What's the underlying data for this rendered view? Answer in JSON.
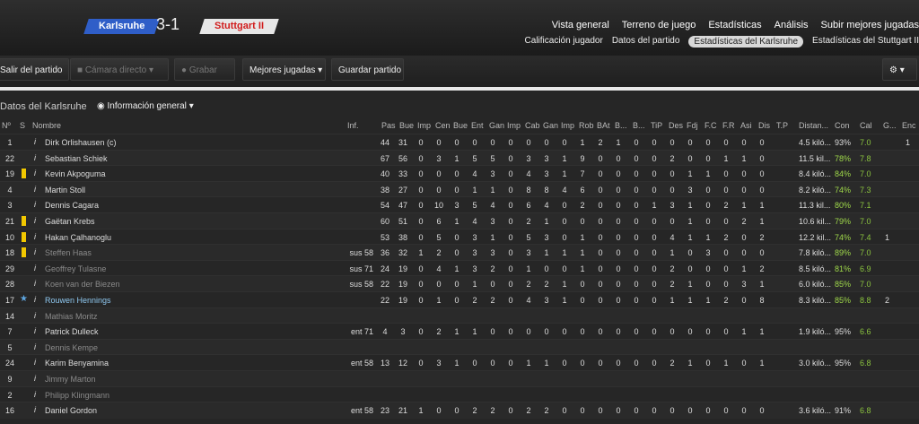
{
  "match": {
    "home": "Karlsruhe",
    "score": "3-1",
    "away": "Stuttgart II"
  },
  "nav_main": [
    "Vista general",
    "Terreno de juego",
    "Estadísticas",
    "Análisis",
    "Subir mejores jugadas"
  ],
  "nav_sub": [
    "Calificación jugador",
    "Datos del partido",
    "Estadísticas del Karlsruhe",
    "Estadísticas del Stuttgart II"
  ],
  "toolbar": {
    "exit": "Salir del partido",
    "camera": "Cámara directo",
    "record": "Grabar",
    "best": "Mejores jugadas",
    "save": "Guardar partido"
  },
  "section": {
    "title": "Datos del Karlsruhe",
    "view": "Información general"
  },
  "columns": [
    "Nº",
    "S",
    "Nombre",
    "Inf.",
    "Pas",
    "Bue",
    "Imp",
    "Cen",
    "Bue",
    "Ent",
    "Gan",
    "Imp",
    "Cab",
    "Gan",
    "Imp",
    "Rob",
    "BAt",
    "B...",
    "B...",
    "TiP",
    "Des",
    "Fdj",
    "F.C",
    "F.R",
    "Asi",
    "Dis",
    "T.P",
    "Distan...",
    "Con",
    "Cal",
    "G...",
    "Enc"
  ],
  "rows": [
    {
      "n": "1",
      "card": "",
      "name": "Dirk Orlishausen (c)",
      "inf": "",
      "style": "",
      "v": [
        "44",
        "31",
        "0",
        "0",
        "0",
        "0",
        "0",
        "0",
        "0",
        "0",
        "0",
        "1",
        "2",
        "1",
        "0",
        "0",
        "0",
        "0",
        "0",
        "0",
        "0",
        "0"
      ],
      "dist": "4.5 kiló...",
      "con": "93%",
      "cal": "7.0",
      "g": "",
      "enc": "1"
    },
    {
      "n": "22",
      "card": "",
      "name": "Sebastian Schiek",
      "inf": "",
      "style": "",
      "v": [
        "67",
        "56",
        "0",
        "3",
        "1",
        "5",
        "5",
        "0",
        "3",
        "3",
        "1",
        "9",
        "0",
        "0",
        "0",
        "0",
        "2",
        "0",
        "0",
        "1",
        "1",
        "0"
      ],
      "dist": "11.5 kil...",
      "con": "78%",
      "cal": "7.8",
      "g": "",
      "enc": ""
    },
    {
      "n": "19",
      "card": "y",
      "name": "Kevin Akpoguma",
      "inf": "",
      "style": "",
      "v": [
        "40",
        "33",
        "0",
        "0",
        "0",
        "4",
        "3",
        "0",
        "4",
        "3",
        "1",
        "7",
        "0",
        "0",
        "0",
        "0",
        "0",
        "1",
        "1",
        "0",
        "0",
        "0"
      ],
      "dist": "8.4 kiló...",
      "con": "84%",
      "cal": "7.0",
      "g": "",
      "enc": ""
    },
    {
      "n": "4",
      "card": "",
      "name": "Martin Stoll",
      "inf": "",
      "style": "",
      "v": [
        "38",
        "27",
        "0",
        "0",
        "0",
        "1",
        "1",
        "0",
        "8",
        "8",
        "4",
        "6",
        "0",
        "0",
        "0",
        "0",
        "0",
        "3",
        "0",
        "0",
        "0",
        "0"
      ],
      "dist": "8.2 kiló...",
      "con": "74%",
      "cal": "7.3",
      "g": "",
      "enc": ""
    },
    {
      "n": "3",
      "card": "",
      "name": "Dennis Cagara",
      "inf": "",
      "style": "",
      "v": [
        "54",
        "47",
        "0",
        "10",
        "3",
        "5",
        "4",
        "0",
        "6",
        "4",
        "0",
        "2",
        "0",
        "0",
        "0",
        "1",
        "3",
        "1",
        "0",
        "2",
        "1",
        "1"
      ],
      "dist": "11.3 kil...",
      "con": "80%",
      "cal": "7.1",
      "g": "",
      "enc": ""
    },
    {
      "n": "21",
      "card": "y",
      "name": "Gaëtan Krebs",
      "inf": "",
      "style": "",
      "v": [
        "60",
        "51",
        "0",
        "6",
        "1",
        "4",
        "3",
        "0",
        "2",
        "1",
        "0",
        "0",
        "0",
        "0",
        "0",
        "0",
        "0",
        "1",
        "0",
        "0",
        "2",
        "1"
      ],
      "dist": "10.6 kil...",
      "con": "79%",
      "cal": "7.0",
      "g": "",
      "enc": ""
    },
    {
      "n": "10",
      "card": "y",
      "name": "Hakan Çalhanoglu",
      "inf": "",
      "style": "",
      "v": [
        "53",
        "38",
        "0",
        "5",
        "0",
        "3",
        "1",
        "0",
        "5",
        "3",
        "0",
        "1",
        "0",
        "0",
        "0",
        "0",
        "4",
        "1",
        "1",
        "2",
        "0",
        "2"
      ],
      "dist": "12.2 kil...",
      "con": "74%",
      "cal": "7.4",
      "g": "1",
      "enc": ""
    },
    {
      "n": "18",
      "card": "y",
      "name": "Steffen Haas",
      "inf": "sus 58",
      "style": "grey",
      "v": [
        "36",
        "32",
        "1",
        "2",
        "0",
        "3",
        "3",
        "0",
        "3",
        "1",
        "1",
        "1",
        "0",
        "0",
        "0",
        "0",
        "1",
        "0",
        "3",
        "0",
        "0",
        "0"
      ],
      "dist": "7.8 kiló...",
      "con": "89%",
      "cal": "7.0",
      "g": "",
      "enc": ""
    },
    {
      "n": "29",
      "card": "",
      "name": "Geoffrey Tulasne",
      "inf": "sus 71",
      "style": "grey",
      "v": [
        "24",
        "19",
        "0",
        "4",
        "1",
        "3",
        "2",
        "0",
        "1",
        "0",
        "0",
        "1",
        "0",
        "0",
        "0",
        "0",
        "2",
        "0",
        "0",
        "0",
        "1",
        "2"
      ],
      "dist": "8.5 kiló...",
      "con": "81%",
      "cal": "6.9",
      "g": "",
      "enc": ""
    },
    {
      "n": "28",
      "card": "",
      "name": "Koen van der Biezen",
      "inf": "sus 58",
      "style": "grey",
      "v": [
        "22",
        "19",
        "0",
        "0",
        "0",
        "1",
        "0",
        "0",
        "2",
        "2",
        "1",
        "0",
        "0",
        "0",
        "0",
        "0",
        "2",
        "1",
        "0",
        "0",
        "3",
        "1"
      ],
      "dist": "6.0 kiló...",
      "con": "85%",
      "cal": "7.0",
      "g": "",
      "enc": ""
    },
    {
      "n": "17",
      "card": "star",
      "name": "Rouwen Hennings",
      "inf": "",
      "style": "blue",
      "v": [
        "22",
        "19",
        "0",
        "1",
        "0",
        "2",
        "2",
        "0",
        "4",
        "3",
        "1",
        "0",
        "0",
        "0",
        "0",
        "0",
        "1",
        "1",
        "1",
        "2",
        "0",
        "8"
      ],
      "dist": "8.3 kiló...",
      "con": "85%",
      "cal": "8.8",
      "g": "2",
      "enc": ""
    },
    {
      "n": "14",
      "card": "",
      "name": "Mathias Moritz",
      "inf": "",
      "style": "grey",
      "v": null,
      "dist": "",
      "con": "",
      "cal": "",
      "g": "",
      "enc": ""
    },
    {
      "n": "7",
      "card": "",
      "name": "Patrick Dulleck",
      "inf": "ent 71",
      "style": "",
      "v": [
        "4",
        "3",
        "0",
        "2",
        "1",
        "1",
        "0",
        "0",
        "0",
        "0",
        "0",
        "0",
        "0",
        "0",
        "0",
        "0",
        "0",
        "0",
        "0",
        "0",
        "1",
        "1"
      ],
      "dist": "1.9 kiló...",
      "con": "95%",
      "cal": "6.6",
      "g": "",
      "enc": ""
    },
    {
      "n": "5",
      "card": "",
      "name": "Dennis Kempe",
      "inf": "",
      "style": "grey",
      "v": null,
      "dist": "",
      "con": "",
      "cal": "",
      "g": "",
      "enc": ""
    },
    {
      "n": "24",
      "card": "",
      "name": "Karim Benyamina",
      "inf": "ent 58",
      "style": "",
      "v": [
        "13",
        "12",
        "0",
        "3",
        "1",
        "0",
        "0",
        "0",
        "1",
        "1",
        "0",
        "0",
        "0",
        "0",
        "0",
        "0",
        "2",
        "1",
        "0",
        "1",
        "0",
        "1"
      ],
      "dist": "3.0 kiló...",
      "con": "95%",
      "cal": "6.8",
      "g": "",
      "enc": ""
    },
    {
      "n": "9",
      "card": "",
      "name": "Jimmy Marton",
      "inf": "",
      "style": "grey",
      "v": null,
      "dist": "",
      "con": "",
      "cal": "",
      "g": "",
      "enc": ""
    },
    {
      "n": "2",
      "card": "",
      "name": "Philipp Klingmann",
      "inf": "",
      "style": "grey",
      "v": null,
      "dist": "",
      "con": "",
      "cal": "",
      "g": "",
      "enc": ""
    },
    {
      "n": "16",
      "card": "",
      "name": "Daniel Gordon",
      "inf": "ent 58",
      "style": "",
      "v": [
        "23",
        "21",
        "1",
        "0",
        "0",
        "2",
        "2",
        "0",
        "2",
        "2",
        "0",
        "0",
        "0",
        "0",
        "0",
        "0",
        "0",
        "0",
        "0",
        "0",
        "0",
        "0"
      ],
      "dist": "3.6 kiló...",
      "con": "91%",
      "cal": "6.8",
      "g": "",
      "enc": ""
    }
  ]
}
